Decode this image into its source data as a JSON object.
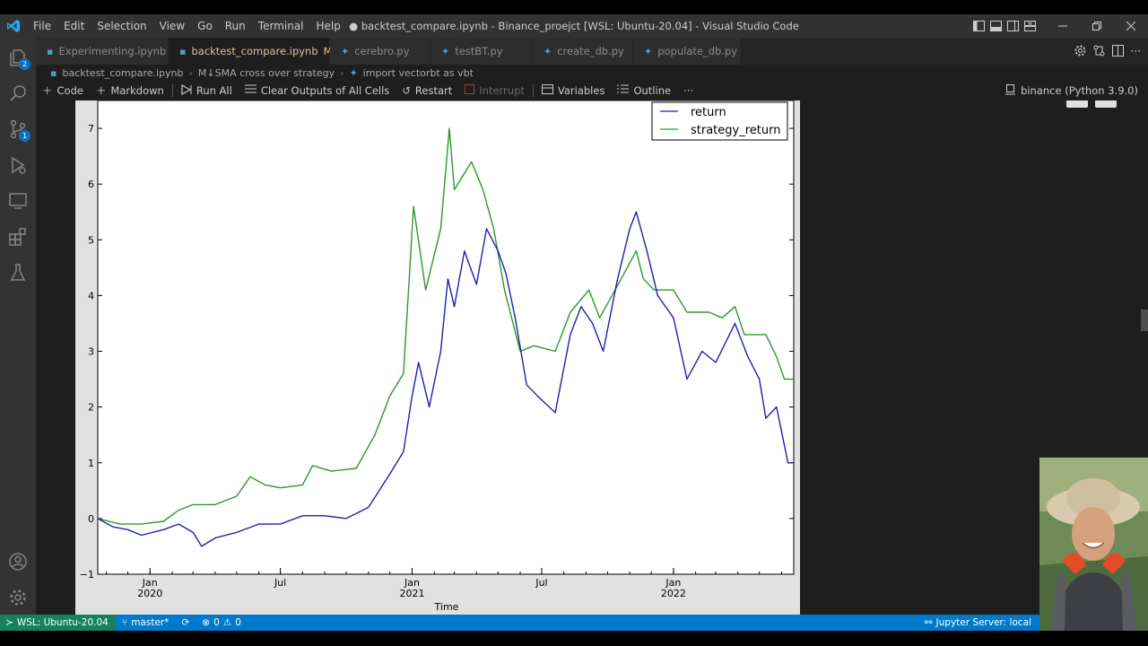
{
  "window": {
    "title": "● backtest_compare.ipynb - Binance_proejct [WSL: Ubuntu-20.04] - Visual Studio Code"
  },
  "menu": [
    "File",
    "Edit",
    "Selection",
    "View",
    "Go",
    "Run",
    "Terminal",
    "Help"
  ],
  "tabs": [
    {
      "label": "Experimenting.ipynb",
      "icon": "notebook-icon",
      "dirty": "●",
      "modified": ""
    },
    {
      "label": "backtest_compare.ipynb",
      "icon": "notebook-icon",
      "dirty": "●",
      "modified": "M"
    },
    {
      "label": "cerebro.py",
      "icon": "python-icon",
      "dirty": "",
      "modified": ""
    },
    {
      "label": "testBT.py",
      "icon": "python-icon",
      "dirty": "",
      "modified": ""
    },
    {
      "label": "create_db.py",
      "icon": "python-icon",
      "dirty": "",
      "modified": ""
    },
    {
      "label": "populate_db.py",
      "icon": "python-icon",
      "dirty": "",
      "modified": ""
    }
  ],
  "breadcrumb": [
    "backtest_compare.ipynb",
    "M↓SMA cross over strategy",
    "import vectorbt as vbt"
  ],
  "toolbar": {
    "code": "Code",
    "markdown": "Markdown",
    "run_all": "Run All",
    "clear_outputs": "Clear Outputs of All Cells",
    "restart": "Restart",
    "interrupt": "Interrupt",
    "variables": "Variables",
    "outline": "Outline",
    "more": "···",
    "kernel": "binance (Python 3.9.0)"
  },
  "activity_badges": {
    "explorer": "2",
    "source_control": "1"
  },
  "status": {
    "remote": "WSL: Ubuntu-20.04",
    "branch": "master*",
    "errors": "0",
    "warnings": "0",
    "jupyter": "Jupyter Server: local"
  },
  "colors": {
    "return": "#1f1faf",
    "strategy_return": "#2a9a2a",
    "statusbar": "#007acc",
    "remote": "#16825d"
  },
  "chart_data": {
    "type": "line",
    "xlabel": "Time",
    "ylabel": "",
    "ylim": [
      -1,
      7.5
    ],
    "yticks": [
      "−1",
      "0",
      "1",
      "2",
      "3",
      "4",
      "5",
      "6",
      "7"
    ],
    "xticks": [
      {
        "date": "2020-01-01",
        "label": "Jan",
        "year": "2020"
      },
      {
        "date": "2020-07-01",
        "label": "Jul",
        "year": ""
      },
      {
        "date": "2021-01-01",
        "label": "Jan",
        "year": "2021"
      },
      {
        "date": "2021-07-01",
        "label": "Jul",
        "year": ""
      },
      {
        "date": "2022-01-01",
        "label": "Jan",
        "year": "2022"
      }
    ],
    "xlim": [
      "2019-10-20",
      "2022-06-18"
    ],
    "legend": "top-right",
    "series": [
      {
        "name": "return",
        "points": [
          [
            "2019-10-20",
            0.0
          ],
          [
            "2019-11-10",
            -0.15
          ],
          [
            "2019-12-01",
            -0.2
          ],
          [
            "2019-12-20",
            -0.3
          ],
          [
            "2020-01-20",
            -0.2
          ],
          [
            "2020-02-10",
            -0.1
          ],
          [
            "2020-03-01",
            -0.25
          ],
          [
            "2020-03-13",
            -0.5
          ],
          [
            "2020-04-01",
            -0.35
          ],
          [
            "2020-05-01",
            -0.25
          ],
          [
            "2020-06-01",
            -0.1
          ],
          [
            "2020-07-01",
            -0.1
          ],
          [
            "2020-08-01",
            0.05
          ],
          [
            "2020-09-01",
            0.05
          ],
          [
            "2020-10-01",
            0.0
          ],
          [
            "2020-11-01",
            0.2
          ],
          [
            "2020-12-01",
            0.8
          ],
          [
            "2020-12-20",
            1.2
          ],
          [
            "2021-01-01",
            2.2
          ],
          [
            "2021-01-10",
            2.8
          ],
          [
            "2021-01-25",
            2.0
          ],
          [
            "2021-02-10",
            3.0
          ],
          [
            "2021-02-20",
            4.3
          ],
          [
            "2021-03-01",
            3.8
          ],
          [
            "2021-03-15",
            4.8
          ],
          [
            "2021-04-01",
            4.2
          ],
          [
            "2021-04-15",
            5.2
          ],
          [
            "2021-05-01",
            4.8
          ],
          [
            "2021-05-12",
            4.4
          ],
          [
            "2021-05-25",
            3.6
          ],
          [
            "2021-06-10",
            2.4
          ],
          [
            "2021-06-25",
            2.2
          ],
          [
            "2021-07-20",
            1.9
          ],
          [
            "2021-08-10",
            3.3
          ],
          [
            "2021-08-25",
            3.8
          ],
          [
            "2021-09-10",
            3.5
          ],
          [
            "2021-09-25",
            3.0
          ],
          [
            "2021-10-15",
            4.3
          ],
          [
            "2021-11-01",
            5.2
          ],
          [
            "2021-11-10",
            5.5
          ],
          [
            "2021-11-25",
            4.8
          ],
          [
            "2021-12-10",
            4.0
          ],
          [
            "2022-01-01",
            3.6
          ],
          [
            "2022-01-20",
            2.5
          ],
          [
            "2022-02-10",
            3.0
          ],
          [
            "2022-03-01",
            2.8
          ],
          [
            "2022-03-28",
            3.5
          ],
          [
            "2022-04-15",
            2.9
          ],
          [
            "2022-05-01",
            2.5
          ],
          [
            "2022-05-10",
            1.8
          ],
          [
            "2022-05-25",
            2.0
          ],
          [
            "2022-06-10",
            1.0
          ],
          [
            "2022-06-18",
            1.0
          ]
        ]
      },
      {
        "name": "strategy_return",
        "points": [
          [
            "2019-10-20",
            0.0
          ],
          [
            "2019-11-20",
            -0.1
          ],
          [
            "2019-12-20",
            -0.1
          ],
          [
            "2020-01-20",
            -0.05
          ],
          [
            "2020-02-10",
            0.15
          ],
          [
            "2020-03-01",
            0.25
          ],
          [
            "2020-04-01",
            0.25
          ],
          [
            "2020-05-01",
            0.4
          ],
          [
            "2020-05-20",
            0.75
          ],
          [
            "2020-06-10",
            0.6
          ],
          [
            "2020-07-01",
            0.55
          ],
          [
            "2020-08-01",
            0.6
          ],
          [
            "2020-08-15",
            0.95
          ],
          [
            "2020-09-10",
            0.85
          ],
          [
            "2020-10-15",
            0.9
          ],
          [
            "2020-11-10",
            1.5
          ],
          [
            "2020-12-01",
            2.2
          ],
          [
            "2020-12-20",
            2.6
          ],
          [
            "2021-01-03",
            5.6
          ],
          [
            "2021-01-20",
            4.1
          ],
          [
            "2021-02-10",
            5.2
          ],
          [
            "2021-02-22",
            7.0
          ],
          [
            "2021-03-01",
            5.9
          ],
          [
            "2021-03-25",
            6.4
          ],
          [
            "2021-04-10",
            5.9
          ],
          [
            "2021-04-25",
            5.2
          ],
          [
            "2021-05-10",
            4.1
          ],
          [
            "2021-06-01",
            3.0
          ],
          [
            "2021-06-20",
            3.1
          ],
          [
            "2021-07-20",
            3.0
          ],
          [
            "2021-08-10",
            3.7
          ],
          [
            "2021-09-05",
            4.1
          ],
          [
            "2021-09-20",
            3.6
          ],
          [
            "2021-10-20",
            4.3
          ],
          [
            "2021-11-10",
            4.8
          ],
          [
            "2021-11-20",
            4.3
          ],
          [
            "2021-12-05",
            4.1
          ],
          [
            "2022-01-01",
            4.1
          ],
          [
            "2022-01-20",
            3.7
          ],
          [
            "2022-02-20",
            3.7
          ],
          [
            "2022-03-10",
            3.6
          ],
          [
            "2022-03-28",
            3.8
          ],
          [
            "2022-04-10",
            3.3
          ],
          [
            "2022-05-10",
            3.3
          ],
          [
            "2022-05-25",
            2.9
          ],
          [
            "2022-06-05",
            2.5
          ],
          [
            "2022-06-18",
            2.5
          ]
        ]
      }
    ]
  }
}
